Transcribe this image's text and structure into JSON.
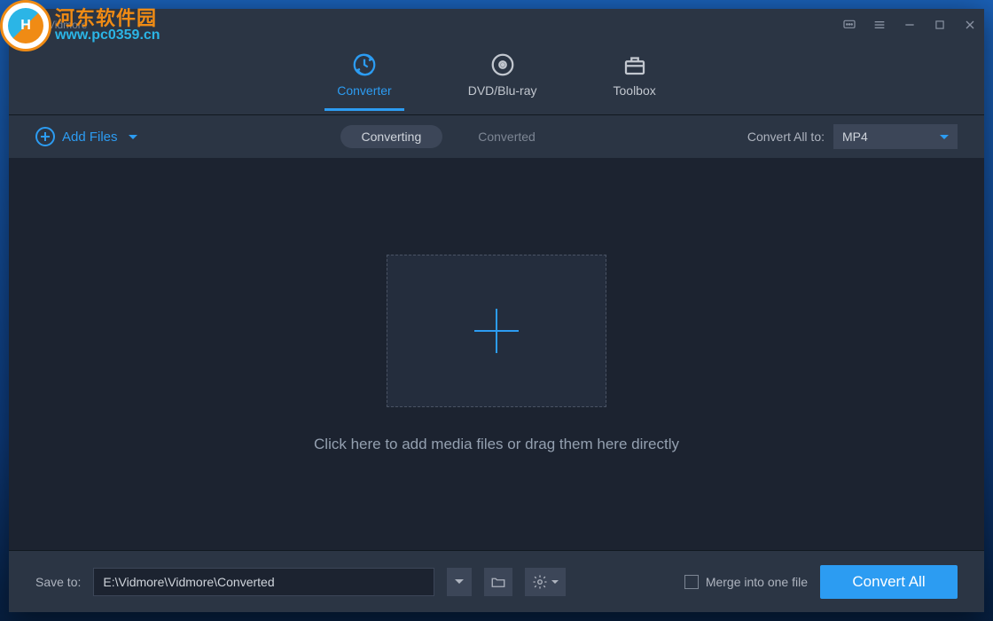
{
  "titlebar": {
    "app_name": "Vidmore"
  },
  "topnav": {
    "converter": "Converter",
    "dvd": "DVD/Blu-ray",
    "toolbox": "Toolbox"
  },
  "subbar": {
    "add_files": "Add Files",
    "converting": "Converting",
    "converted": "Converted",
    "convert_all_to": "Convert All to:",
    "format": "MP4"
  },
  "main": {
    "drop_text": "Click here to add media files or drag them here directly"
  },
  "bottombar": {
    "save_to": "Save to:",
    "path": "E:\\Vidmore\\Vidmore\\Converted",
    "merge": "Merge into one file",
    "convert_all": "Convert All"
  },
  "watermark": {
    "line1": "河东软件园",
    "line2": "www.pc0359.cn"
  }
}
